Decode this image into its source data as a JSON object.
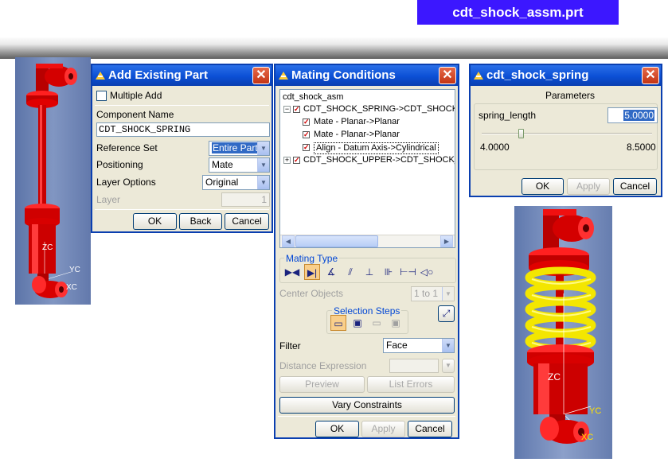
{
  "file_title": "cdt_shock_assm.prt",
  "add_existing_part": {
    "title": "Add Existing Part",
    "multiple_add_label": "Multiple Add",
    "component_name_label": "Component Name",
    "component_name_value": "CDT_SHOCK_SPRING",
    "reference_set_label": "Reference Set",
    "reference_set_value": "Entire Part",
    "positioning_label": "Positioning",
    "positioning_value": "Mate",
    "layer_options_label": "Layer Options",
    "layer_options_value": "Original",
    "layer_label": "Layer",
    "layer_value": "1",
    "ok": "OK",
    "back": "Back",
    "cancel": "Cancel"
  },
  "mating_conditions": {
    "title": "Mating Conditions",
    "tree": [
      "cdt_shock_asm",
      "CDT_SHOCK_SPRING->CDT_SHOCK",
      "Mate - Planar->Planar",
      "Mate - Planar->Planar",
      "Align - Datum Axis->Cylindrical",
      "CDT_SHOCK_UPPER->CDT_SHOCK_"
    ],
    "mating_type_label": "Mating Type",
    "center_objects_label": "Center Objects",
    "center_objects_value": "1 to 1",
    "selection_steps_label": "Selection Steps",
    "filter_label": "Filter",
    "filter_value": "Face",
    "distance_expression_label": "Distance Expression",
    "preview": "Preview",
    "list_errors": "List Errors",
    "vary_constraints": "Vary Constraints",
    "ok": "OK",
    "apply": "Apply",
    "cancel": "Cancel"
  },
  "spring_dialog": {
    "title": "cdt_shock_spring",
    "parameters_label": "Parameters",
    "param_name": "spring_length",
    "param_value": "5.0000",
    "slider_min": "4.0000",
    "slider_max": "8.5000",
    "slider_value": 5.0,
    "ok": "OK",
    "apply": "Apply",
    "cancel": "Cancel"
  },
  "model_labels": {
    "zc": "ZC",
    "yc": "YC",
    "xc": "XC"
  },
  "colors": {
    "title_bar": "#0b4fd5",
    "model_red": "#e00000",
    "spring_yellow": "#f3e600",
    "viewport_bg": "#6f86b8",
    "file_title_bg": "#3c17ff"
  }
}
